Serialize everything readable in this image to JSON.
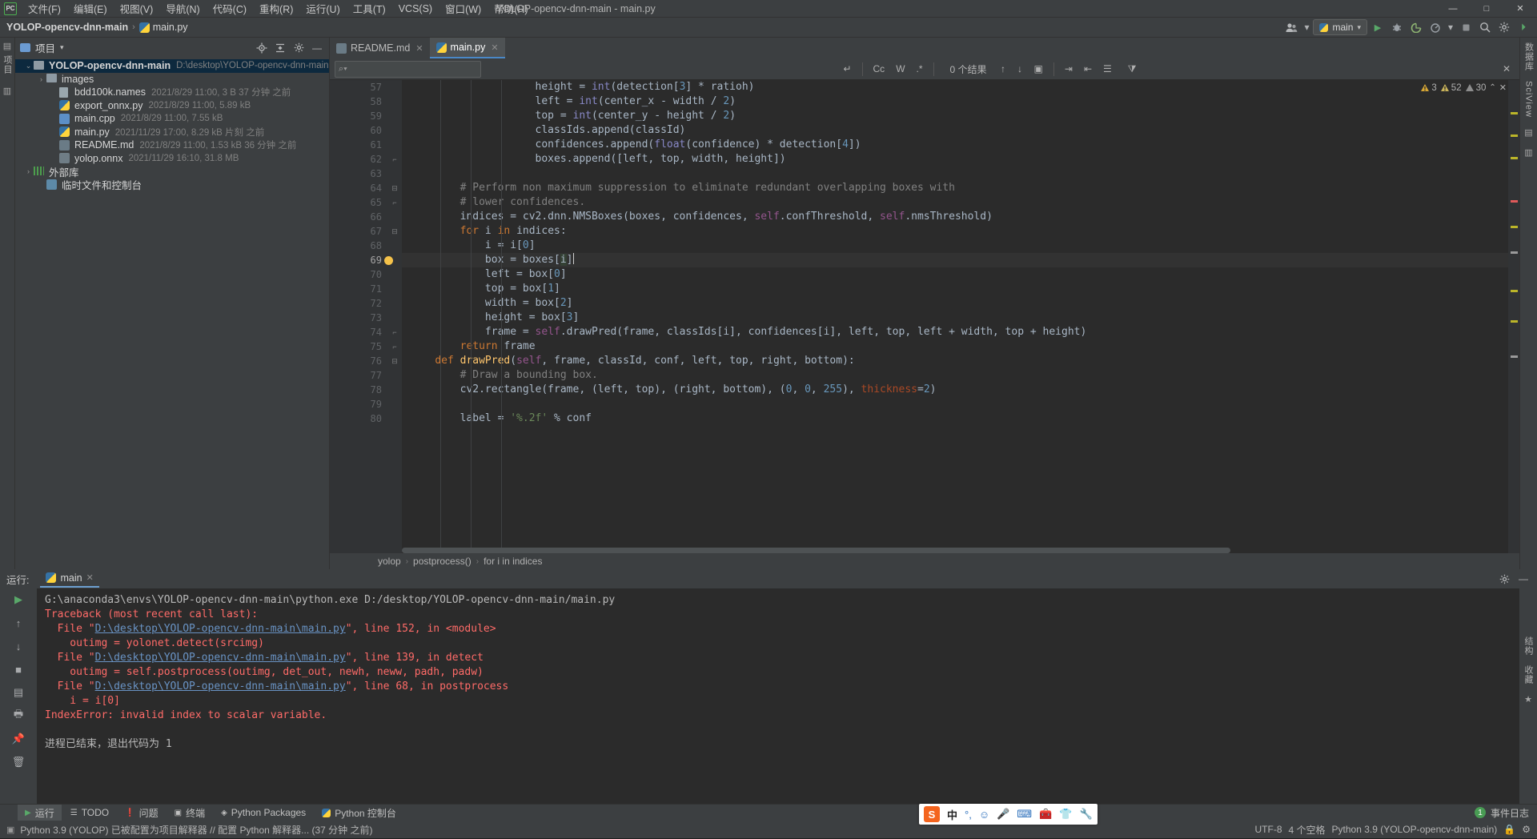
{
  "titlebar": {
    "logo": "PC",
    "menus": [
      {
        "label": "文件(F)"
      },
      {
        "label": "编辑(E)"
      },
      {
        "label": "视图(V)"
      },
      {
        "label": "导航(N)"
      },
      {
        "label": "代码(C)"
      },
      {
        "label": "重构(R)"
      },
      {
        "label": "运行(U)"
      },
      {
        "label": "工具(T)"
      },
      {
        "label": "VCS(S)"
      },
      {
        "label": "窗口(W)"
      },
      {
        "label": "帮助(H)"
      }
    ],
    "window_title": "YOLOP-opencv-dnn-main - main.py",
    "minimize": "—",
    "maximize": "□",
    "close": "✕"
  },
  "navbar": {
    "project_crumb": "YOLOP-opencv-dnn-main",
    "file_crumb": "main.py",
    "separator": "›",
    "run_config": "main",
    "icons": {
      "collaborate": "collaborate-icon",
      "run": "▶",
      "debug": "debug-icon",
      "coverage": "coverage-icon",
      "profile": "profile-icon",
      "search": "⚲",
      "settings": "⚙",
      "more": "⋮"
    }
  },
  "left_strip": {
    "labels": [
      "项目",
      "收藏"
    ]
  },
  "project_panel": {
    "title": "项目",
    "dropdown": "▾",
    "actions": [
      "locate-icon",
      "collapse-all-icon",
      "settings-icon",
      "hide-icon"
    ],
    "tree": [
      {
        "indent": 0,
        "arrow": "⌄",
        "icon": "folder-icon",
        "name": "YOLOP-opencv-dnn-main",
        "bold": true,
        "meta": "D:\\desktop\\YOLOP-opencv-dnn-main",
        "selected": true
      },
      {
        "indent": 1,
        "arrow": "›",
        "icon": "folder-icon",
        "name": "images",
        "bold": false,
        "meta": "",
        "selected": false
      },
      {
        "indent": 2,
        "arrow": "",
        "icon": "names-file-icon",
        "name": "bdd100k.names",
        "bold": false,
        "meta": "2021/8/29 11:00, 3 B 37 分钟 之前",
        "selected": false
      },
      {
        "indent": 2,
        "arrow": "",
        "icon": "python-file-icon",
        "name": "export_onnx.py",
        "bold": false,
        "meta": "2021/8/29 11:00, 5.89 kB",
        "selected": false
      },
      {
        "indent": 2,
        "arrow": "",
        "icon": "cpp-file-icon",
        "name": "main.cpp",
        "bold": false,
        "meta": "2021/8/29 11:00, 7.55 kB",
        "selected": false
      },
      {
        "indent": 2,
        "arrow": "",
        "icon": "python-file-icon",
        "name": "main.py",
        "bold": false,
        "meta": "2021/11/29 17:00, 8.29 kB 片刻 之前",
        "selected": false
      },
      {
        "indent": 2,
        "arrow": "",
        "icon": "markdown-file-icon",
        "name": "README.md",
        "bold": false,
        "meta": "2021/8/29 11:00, 1.53 kB 36 分钟 之前",
        "selected": false
      },
      {
        "indent": 2,
        "arrow": "",
        "icon": "onnx-file-icon",
        "name": "yolop.onnx",
        "bold": false,
        "meta": "2021/11/29 16:10, 31.8 MB",
        "selected": false
      },
      {
        "indent": 0,
        "arrow": "›",
        "icon": "library-icon",
        "name": "外部库",
        "bold": false,
        "meta": "",
        "selected": false
      },
      {
        "indent": 1,
        "arrow": "",
        "icon": "scratch-icon",
        "name": "临时文件和控制台",
        "bold": false,
        "meta": "",
        "selected": false
      }
    ]
  },
  "editor": {
    "tabs": [
      {
        "label": "README.md",
        "icon": "markdown-file-icon",
        "active": false
      },
      {
        "label": "main.py",
        "icon": "python-file-icon",
        "active": true
      }
    ],
    "find": {
      "placeholder": "",
      "value": "",
      "toggle_case": "Cc",
      "toggle_word": "W",
      "toggle_regex": ".*",
      "reset_icon": "↵",
      "results": "0 个结果",
      "prev": "↑",
      "next": "↓",
      "select_all": "select-all-icon",
      "exclude": "exclude-icon",
      "open_in_find": "open-find-window-icon",
      "filter": "filter-icon",
      "close": "✕"
    },
    "inspections": {
      "errors": "3",
      "warnings": "52",
      "weak": "30",
      "collapse": "⌃"
    },
    "first_line": 57,
    "current_line": 69,
    "lines": [
      {
        "n": 57,
        "fold": "",
        "text": "                    height = int(detection[3] * ratioh)"
      },
      {
        "n": 58,
        "fold": "",
        "text": "                    left = int(center_x - width / 2)"
      },
      {
        "n": 59,
        "fold": "",
        "text": "                    top = int(center_y - height / 2)"
      },
      {
        "n": 60,
        "fold": "",
        "text": "                    classIds.append(classId)"
      },
      {
        "n": 61,
        "fold": "",
        "text": "                    confidences.append(float(confidence) * detection[4])"
      },
      {
        "n": 62,
        "fold": "end",
        "text": "                    boxes.append([left, top, width, height])"
      },
      {
        "n": 63,
        "fold": "",
        "text": ""
      },
      {
        "n": 64,
        "fold": "start",
        "text": "        # Perform non maximum suppression to eliminate redundant overlapping boxes with"
      },
      {
        "n": 65,
        "fold": "end",
        "text": "        # lower confidences."
      },
      {
        "n": 66,
        "fold": "",
        "text": "        indices = cv2.dnn.NMSBoxes(boxes, confidences, self.confThreshold, self.nmsThreshold)"
      },
      {
        "n": 67,
        "fold": "start",
        "text": "        for i in indices:"
      },
      {
        "n": 68,
        "fold": "",
        "text": "            i = i[0]"
      },
      {
        "n": 69,
        "fold": "",
        "text": "            box = boxes[i]"
      },
      {
        "n": 70,
        "fold": "",
        "text": "            left = box[0]"
      },
      {
        "n": 71,
        "fold": "",
        "text": "            top = box[1]"
      },
      {
        "n": 72,
        "fold": "",
        "text": "            width = box[2]"
      },
      {
        "n": 73,
        "fold": "",
        "text": "            height = box[3]"
      },
      {
        "n": 74,
        "fold": "end",
        "text": "            frame = self.drawPred(frame, classIds[i], confidences[i], left, top, left + width, top + height)"
      },
      {
        "n": 75,
        "fold": "end",
        "text": "        return frame"
      },
      {
        "n": 76,
        "fold": "start",
        "text": "    def drawPred(self, frame, classId, conf, left, top, right, bottom):"
      },
      {
        "n": 77,
        "fold": "",
        "text": "        # Draw a bounding box."
      },
      {
        "n": 78,
        "fold": "",
        "text": "        cv2.rectangle(frame, (left, top), (right, bottom), (0, 0, 255), thickness=2)"
      },
      {
        "n": 79,
        "fold": "",
        "text": ""
      },
      {
        "n": 80,
        "fold": "",
        "text": "        label = '%.2f' % conf"
      }
    ],
    "breadcrumbs": [
      "yolop",
      "postprocess()",
      "for i in indices"
    ],
    "breadcrumb_sep": "›"
  },
  "right_strip": {
    "labels": [
      "数据库",
      "SciView"
    ]
  },
  "run_panel": {
    "label": "运行:",
    "tab": "main",
    "tab_close": "✕",
    "settings_icon": "⚙",
    "hide_icon": "—",
    "tools": [
      "run-icon",
      "scroll-up-icon",
      "scroll-down-icon",
      "stop-icon",
      "soft-wrap-icon",
      "print-icon",
      "pin-icon",
      "trash-icon"
    ],
    "console": [
      {
        "type": "plain",
        "text": "G:\\anaconda3\\envs\\YOLOP-opencv-dnn-main\\python.exe D:/desktop/YOLOP-opencv-dnn-main/main.py"
      },
      {
        "type": "error",
        "text": "Traceback (most recent call last):"
      },
      {
        "type": "file",
        "prefix": "  File \"",
        "link": "D:\\desktop\\YOLOP-opencv-dnn-main\\main.py",
        "suffix": "\", line 152, in <module>"
      },
      {
        "type": "error",
        "text": "    outimg = yolonet.detect(srcimg)"
      },
      {
        "type": "file",
        "prefix": "  File \"",
        "link": "D:\\desktop\\YOLOP-opencv-dnn-main\\main.py",
        "suffix": "\", line 139, in detect"
      },
      {
        "type": "error",
        "text": "    outimg = self.postprocess(outimg, det_out, newh, neww, padh, padw)"
      },
      {
        "type": "file",
        "prefix": "  File \"",
        "link": "D:\\desktop\\YOLOP-opencv-dnn-main\\main.py",
        "suffix": "\", line 68, in postprocess"
      },
      {
        "type": "error",
        "text": "    i = i[0]"
      },
      {
        "type": "error",
        "text": "IndexError: invalid index to scalar variable."
      },
      {
        "type": "blank",
        "text": ""
      },
      {
        "type": "plain",
        "text": "进程已结束，退出代码为 1"
      }
    ]
  },
  "toolwindow_bar": {
    "items": [
      {
        "label": "运行",
        "icon": "run-icon",
        "active": true
      },
      {
        "label": "TODO",
        "icon": "todo-icon",
        "active": false
      },
      {
        "label": "问题",
        "icon": "problems-icon",
        "active": false
      },
      {
        "label": "终端",
        "icon": "terminal-icon",
        "active": false
      },
      {
        "label": "Python Packages",
        "icon": "packages-icon",
        "active": false
      },
      {
        "label": "Python 控制台",
        "icon": "python-console-icon",
        "active": false
      }
    ],
    "event_log": "事件日志",
    "event_count": "1"
  },
  "statusbar": {
    "message": "Python 3.9 (YOLOP) 已被配置为项目解释器 // 配置 Python 解释器... (37 分钟 之前)",
    "message_icon": "info-icon",
    "encoding": "UTF-8",
    "indent": "4 个空格",
    "interpreter": "Python 3.9 (YOLOP-opencv-dnn-main)",
    "lock_icon": "lock-icon",
    "vcs_icon": "vcs-icon"
  },
  "ime": {
    "logo": "S",
    "lang": "中",
    "icons": [
      "comma-icon",
      "emoji-icon",
      "mic-icon",
      "keyboard-icon",
      "toolbox-icon",
      "skin-icon",
      "wrench-icon"
    ]
  }
}
